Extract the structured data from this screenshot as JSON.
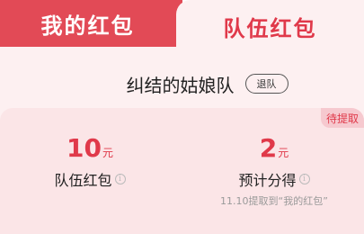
{
  "tabs": {
    "my_red_packet": "我的红包",
    "team_red_packet": "队伍红包"
  },
  "team": {
    "name": "纠结的姑娘队",
    "quit_label": "退队"
  },
  "card": {
    "badge": "待提取",
    "left": {
      "amount": "10",
      "unit": "元",
      "label": "队伍红包"
    },
    "right": {
      "amount": "2",
      "unit": "元",
      "label": "预计分得",
      "hint": "11.10提取到“我的红包”"
    }
  },
  "colors": {
    "accent": "#e24a56",
    "accent_text": "#e0394a",
    "background": "#fdf0f1",
    "card_background": "#fbe5e7"
  },
  "icons": [
    "info-circle-icon"
  ]
}
